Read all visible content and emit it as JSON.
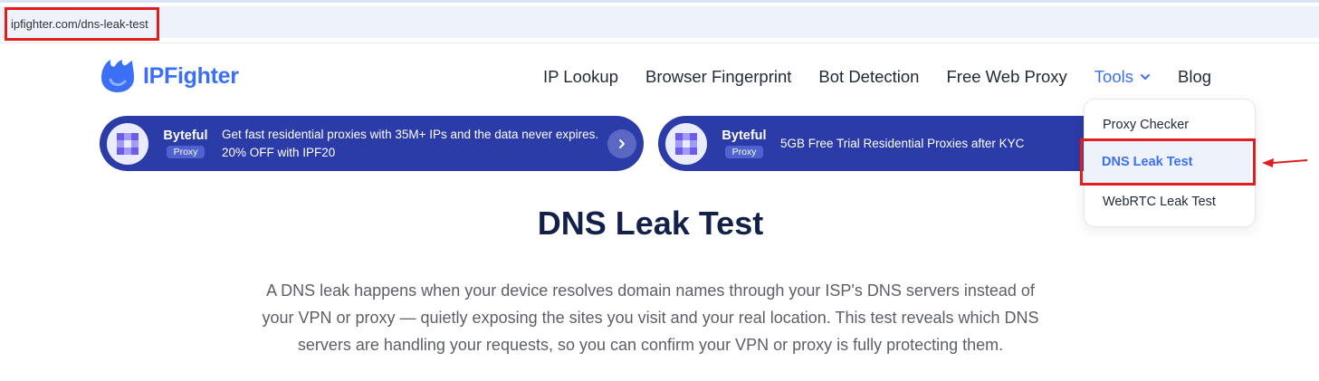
{
  "browser": {
    "url": "ipfighter.com/dns-leak-test"
  },
  "header": {
    "logo_text": "IPFighter",
    "nav": [
      {
        "label": "IP Lookup"
      },
      {
        "label": "Browser Fingerprint"
      },
      {
        "label": "Bot Detection"
      },
      {
        "label": "Free Web Proxy"
      },
      {
        "label": "Tools"
      },
      {
        "label": "Blog"
      }
    ]
  },
  "banners": [
    {
      "brand": "Byteful",
      "tag": "Proxy",
      "text": "Get fast residential proxies with 35M+ IPs and the data never expires. 20% OFF with IPF20"
    },
    {
      "brand": "Byteful",
      "tag": "Proxy",
      "text": "5GB Free Trial Residential Proxies after KYC"
    }
  ],
  "page": {
    "title": "DNS Leak Test",
    "description": "A DNS leak happens when your device resolves domain names through your ISP's DNS servers instead of your VPN or proxy — quietly exposing the sites you visit and your real location. This test reveals which DNS servers are handling your requests, so you can confirm your VPN or proxy is fully protecting them."
  },
  "tools_menu": {
    "items": [
      {
        "label": "Proxy Checker"
      },
      {
        "label": "DNS Leak Test"
      },
      {
        "label": "WebRTC Leak Test"
      }
    ],
    "active_index": 1
  },
  "colors": {
    "brand_blue": "#3b6ff5",
    "banner_bg": "#2b3ba8",
    "title": "#13204a",
    "annotation_red": "#e11d1d"
  }
}
